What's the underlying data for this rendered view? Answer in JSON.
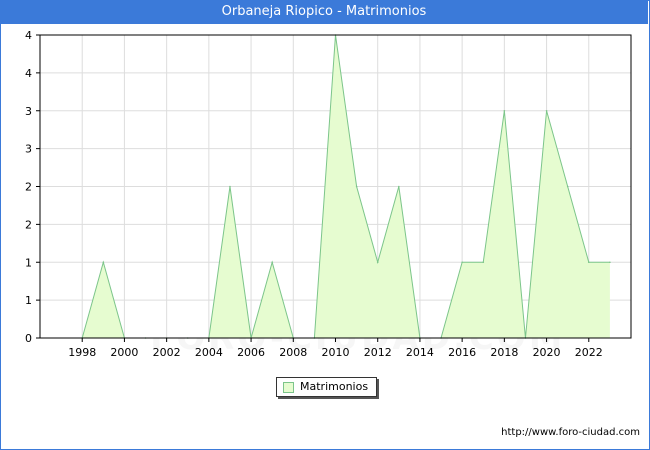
{
  "window": {
    "title": "Orbaneja Riopico - Matrimonios"
  },
  "watermark": "FORO-CIUDAD.COM",
  "source_url": "http://www.foro-ciudad.com",
  "legend": {
    "label": "Matrimonios"
  },
  "colors": {
    "header": "#3b7ad9",
    "fill": "#e6fcd0",
    "line": "#7cc58a",
    "grid": "#dddddd"
  },
  "chart_data": {
    "type": "area",
    "title": "Orbaneja Riopico - Matrimonios",
    "xlabel": "",
    "ylabel": "",
    "ylim": [
      0,
      4
    ],
    "grid": true,
    "legend_position": "bottom",
    "x_ticks": [
      "1998",
      "2000",
      "2002",
      "2004",
      "2006",
      "2008",
      "2010",
      "2012",
      "2014",
      "2016",
      "2018",
      "2020",
      "2022"
    ],
    "y_ticks": [
      "0",
      "1",
      "1",
      "2",
      "2",
      "3",
      "3",
      "4",
      "4"
    ],
    "series": [
      {
        "name": "Matrimonios",
        "x": [
          1998,
          1999,
          2000,
          2001,
          2002,
          2003,
          2004,
          2005,
          2006,
          2007,
          2008,
          2009,
          2010,
          2011,
          2012,
          2013,
          2014,
          2015,
          2016,
          2017,
          2018,
          2019,
          2020,
          2021,
          2022,
          2023
        ],
        "values": [
          0,
          1,
          0,
          0,
          0,
          0,
          0,
          2,
          0,
          1,
          0,
          0,
          4,
          2,
          1,
          2,
          0,
          0,
          1,
          1,
          3,
          0,
          3,
          2,
          1,
          1
        ]
      }
    ]
  }
}
